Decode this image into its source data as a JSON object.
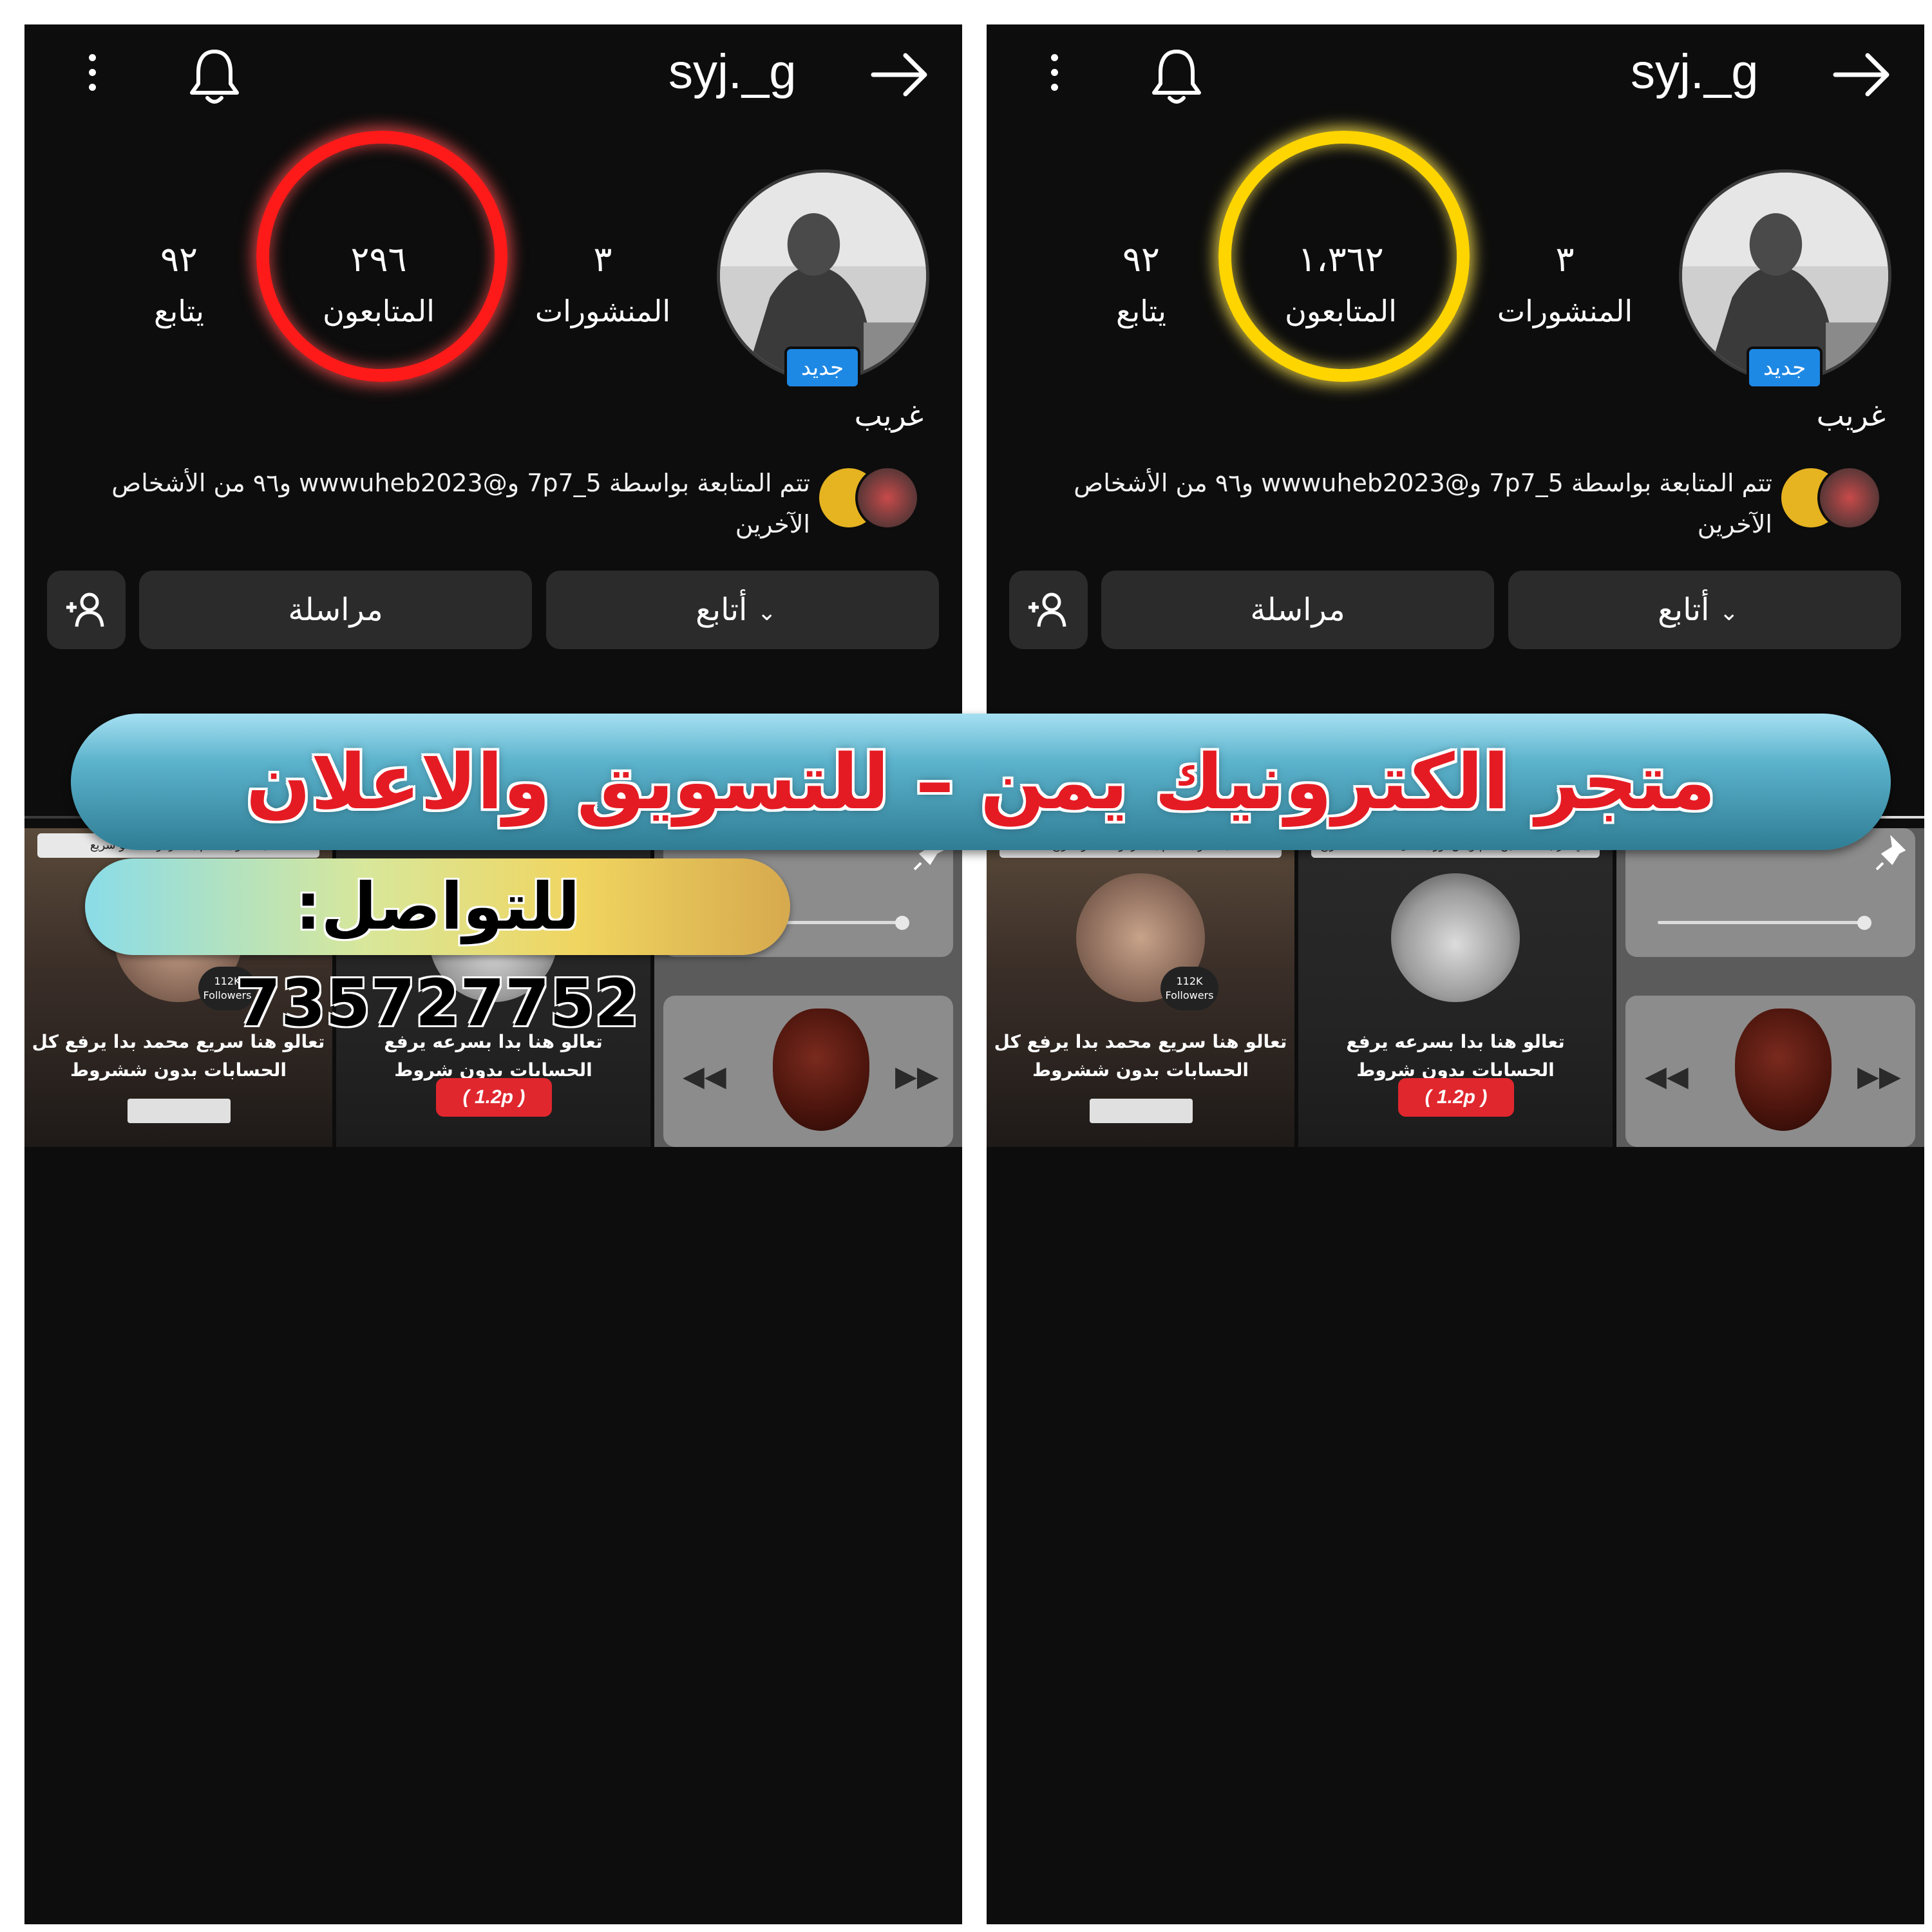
{
  "panels": [
    {
      "username": "syj._g",
      "new_badge": "جديد",
      "stats": {
        "posts_num": "٣",
        "posts_label": "المنشورات",
        "followers_num": "٢٩٦",
        "followers_label": "المتابعون",
        "following_num": "٩٢",
        "following_label": "يتابع"
      },
      "highlight_color": "#ff1a1a",
      "name": "غريب",
      "mutual_text": "تتم المتابعة بواسطة 7p7_5 و@wwwuheb2023 و٩٦ من الأشخاص الآخرين",
      "buttons": {
        "follow": "أتابع",
        "message": "مراسلة"
      },
      "grid": {
        "a_header": "بدا اقوى دعـم بحضرموت لحقو سريع",
        "a_text": "تعالو هنا سريع محمد بدا يرفع كل الحسابات بدون ششروط",
        "a_followers": "112K Followers",
        "b_header": "",
        "b_text": "تعالو هنا بدا بسرعه يرفع الحسابات بدون شروط",
        "b_price": "( 1.2p )"
      }
    },
    {
      "username": "syj._g",
      "new_badge": "جديد",
      "stats": {
        "posts_num": "٣",
        "posts_label": "المنشورات",
        "followers_num": "١،٣٦٢",
        "followers_label": "المتابعون",
        "following_num": "٩٢",
        "following_label": "يتابع"
      },
      "highlight_color": "#ffd500",
      "name": "غريب",
      "mutual_text": "تتم المتابعة بواسطة 7p7_5 و@wwwuheb2023 و٩٦ من الأشخاص الآخرين",
      "buttons": {
        "follow": "أتابع",
        "message": "مراسلة"
      },
      "grid": {
        "a_header": "بدا اقوى دعـم بحضرموت لحقو سريع",
        "a_text": "تعالو هنا سريع محمد بدا يرفع كل الحسابات بدون ششروط",
        "a_followers": "112K Followers",
        "b_header": "تبي عرب متفاعلين عام وبس تورى تعال عند محمد سريع",
        "b_text": "تعالو هنا بدا بسرعه يرفع الحسابات بدون شروط",
        "b_price": "( 1.2p )"
      }
    }
  ],
  "overlay": {
    "banner": "متجر الكترونيك يمن – للتسويق والاعلان",
    "contact": "للتواصل: 735727752"
  }
}
